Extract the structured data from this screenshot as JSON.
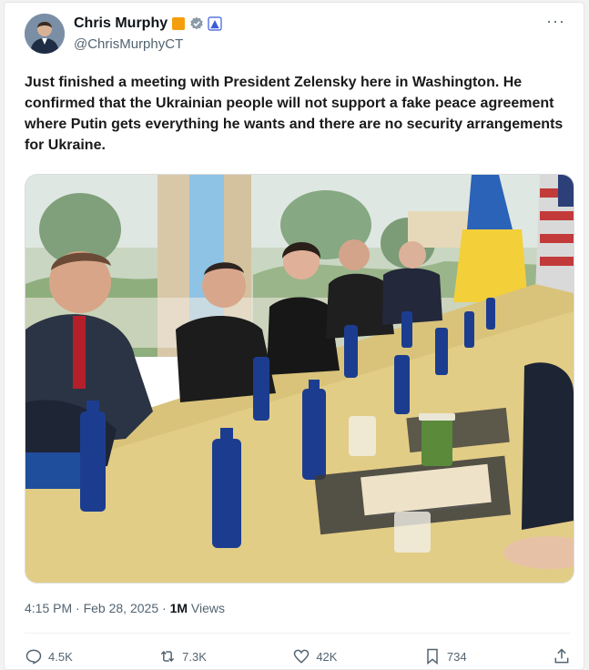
{
  "author": {
    "display_name": "Chris Murphy",
    "handle": "@ChrisMurphyCT"
  },
  "badges": [
    "square-badge-icon",
    "verified-icon",
    "government-icon"
  ],
  "colors": {
    "square_badge": "#f59e0b",
    "verified": "#8a9aa8",
    "link_blue": "#1d9bf0",
    "muted": "#536471"
  },
  "tweet": {
    "text": "Just finished a meeting with President Zelensky here in Washington. He confirmed that the Ukrainian people will not support a fake peace agreement where Putin gets everything he wants and there are no security arrangements for Ukraine."
  },
  "meta": {
    "time": "4:15 PM",
    "sep1": " · ",
    "date": "Feb 28, 2025",
    "sep2": " · ",
    "views_count": "1M",
    "views_label": " Views"
  },
  "actions": {
    "replies": "4.5K",
    "reposts": "7.3K",
    "likes": "42K",
    "bookmarks": "734"
  },
  "more_label": "···"
}
